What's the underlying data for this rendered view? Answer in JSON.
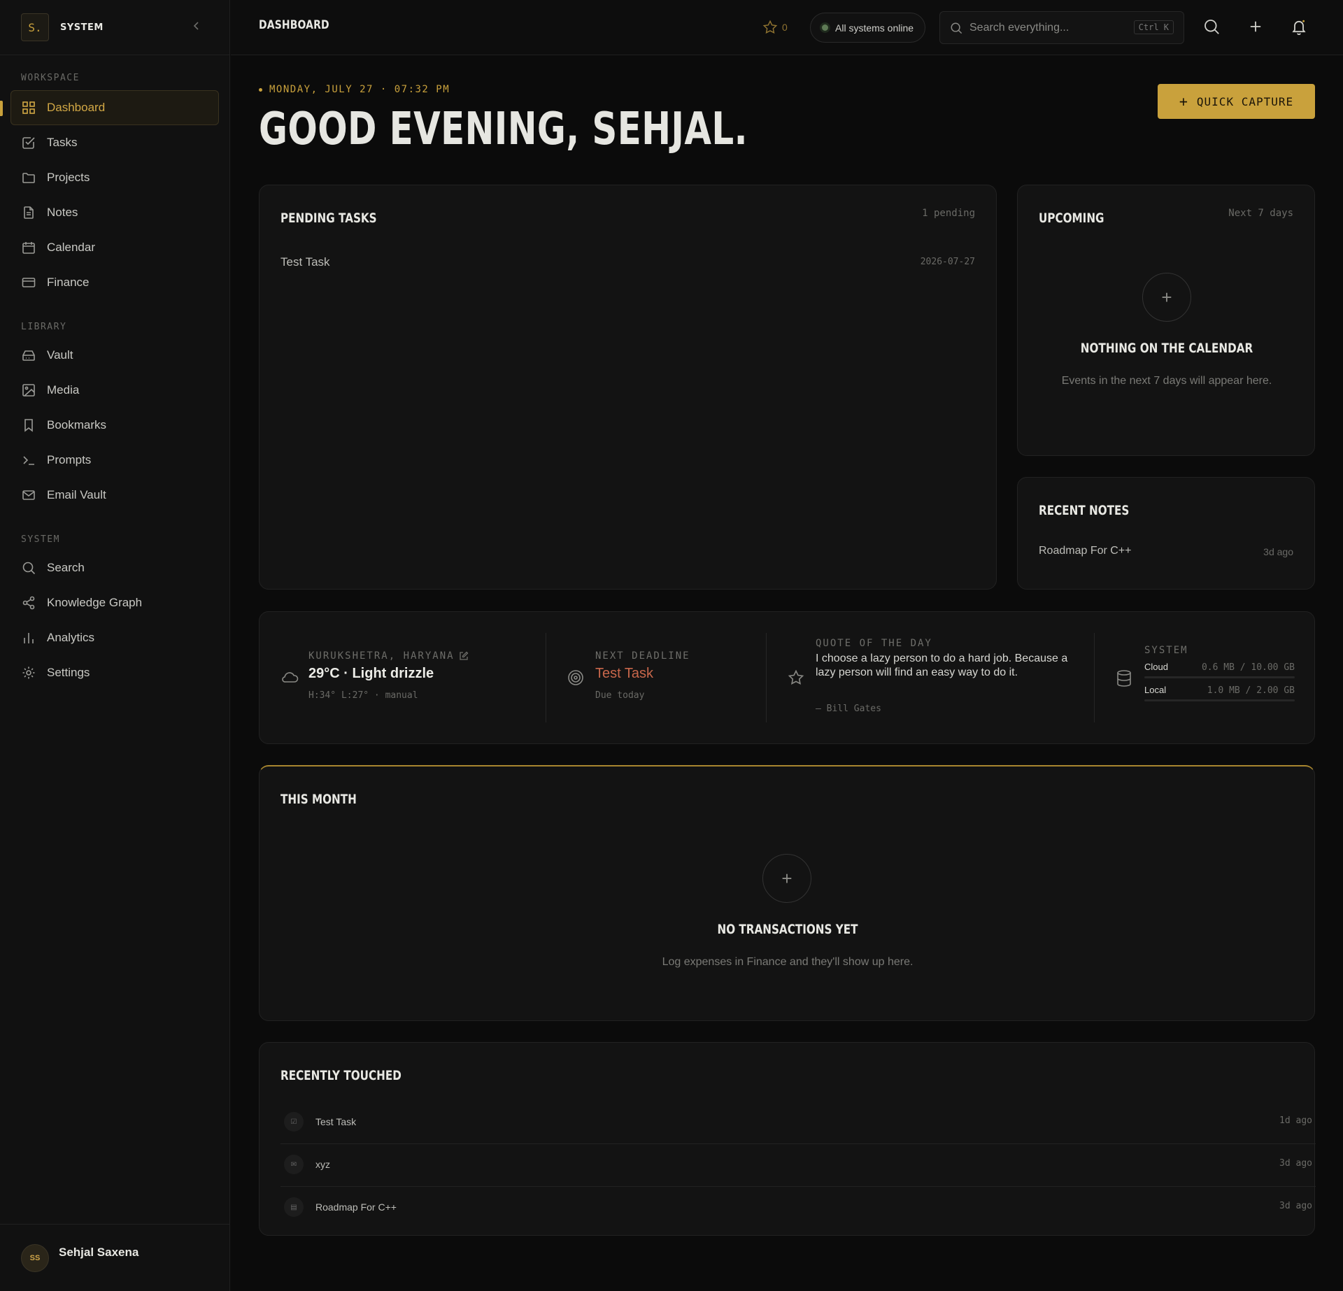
{
  "brand": {
    "logo": "S.",
    "name": "SYSTEM"
  },
  "sidebar": {
    "sections": [
      {
        "heading": "WORKSPACE",
        "items": [
          {
            "label": "Dashboard",
            "icon": "grid-icon",
            "active": true
          },
          {
            "label": "Tasks",
            "icon": "checkbox-icon"
          },
          {
            "label": "Projects",
            "icon": "folder-icon"
          },
          {
            "label": "Notes",
            "icon": "document-icon"
          },
          {
            "label": "Calendar",
            "icon": "calendar-icon"
          },
          {
            "label": "Finance",
            "icon": "credit-card-icon"
          }
        ]
      },
      {
        "heading": "LIBRARY",
        "items": [
          {
            "label": "Vault",
            "icon": "vault-icon"
          },
          {
            "label": "Media",
            "icon": "image-icon"
          },
          {
            "label": "Bookmarks",
            "icon": "bookmark-icon"
          },
          {
            "label": "Prompts",
            "icon": "terminal-icon"
          },
          {
            "label": "Email Vault",
            "icon": "mail-icon"
          }
        ]
      },
      {
        "heading": "SYSTEM",
        "items": [
          {
            "label": "Search",
            "icon": "search-icon"
          },
          {
            "label": "Knowledge Graph",
            "icon": "share-icon"
          },
          {
            "label": "Analytics",
            "icon": "bar-chart-icon"
          },
          {
            "label": "Settings",
            "icon": "gear-icon"
          }
        ]
      }
    ],
    "user": {
      "initials": "SS",
      "name": "Sehjal Saxena"
    }
  },
  "topbar": {
    "title": "DASHBOARD",
    "star_count": "0",
    "status": "All systems online",
    "search_placeholder": "Search everything...",
    "search_shortcut": "Ctrl K"
  },
  "hero": {
    "date": "MONDAY, JULY 27 · 07:32 PM",
    "greeting": "GOOD EVENING, SEHJAL.",
    "capture_label": "QUICK CAPTURE"
  },
  "pending": {
    "title": "PENDING TASKS",
    "meta": "1 pending",
    "tasks": [
      {
        "name": "Test Task",
        "date": "2026-07-27"
      }
    ]
  },
  "upcoming": {
    "title": "UPCOMING",
    "meta": "Next 7 days",
    "empty_title": "NOTHING ON THE CALENDAR",
    "empty_desc": "Events in the next 7 days will appear here."
  },
  "notes": {
    "title": "RECENT NOTES",
    "items": [
      {
        "name": "Roadmap For C++",
        "ago": "3d ago"
      }
    ]
  },
  "info": {
    "weather": {
      "location": "KURUKSHETRA, HARYANA",
      "value": "29°C · Light drizzle",
      "sub": "H:34° L:27° · manual"
    },
    "deadline": {
      "label": "NEXT DEADLINE",
      "task": "Test Task",
      "due": "Due today"
    },
    "quote": {
      "label": "QUOTE OF THE DAY",
      "text": "I choose a lazy person to do a hard job. Because a lazy person will find an easy way to do it.",
      "author": "— Bill Gates"
    },
    "system": {
      "label": "SYSTEM",
      "cloud_label": "Cloud",
      "cloud_value": "0.6 MB / 10.00 GB",
      "local_label": "Local",
      "local_value": "1.0 MB / 2.00 GB"
    }
  },
  "month": {
    "title": "THIS MONTH",
    "empty_title": "NO TRANSACTIONS YET",
    "empty_desc": "Log expenses in Finance and they'll show up here."
  },
  "recent": {
    "title": "RECENTLY TOUCHED",
    "items": [
      {
        "name": "Test Task",
        "ago": "1d ago",
        "icon": "task-icon"
      },
      {
        "name": "xyz",
        "ago": "3d ago",
        "icon": "mail-icon"
      },
      {
        "name": "Roadmap For C++",
        "ago": "3d ago",
        "icon": "note-icon"
      }
    ]
  },
  "colors": {
    "accent": "#c9a13c",
    "background": "#0b0b0b",
    "card": "#131313",
    "deadline": "#c8674b",
    "online": "#5e7a55"
  }
}
